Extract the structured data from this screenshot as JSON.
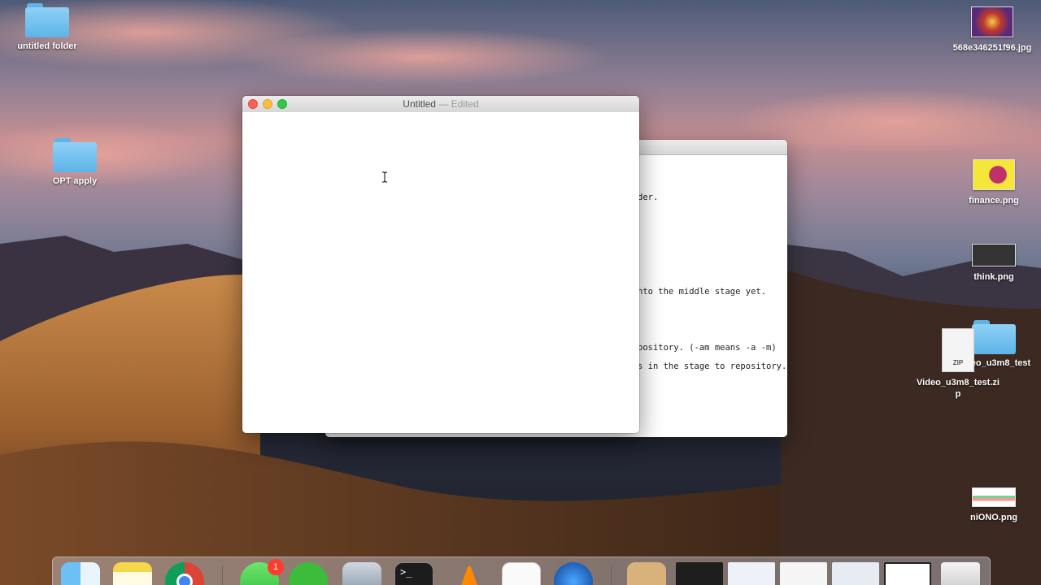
{
  "desktop": {
    "icons": [
      {
        "label": "untitled folder"
      },
      {
        "label": "OPT apply"
      },
      {
        "label": "568e346251f96.jpg"
      },
      {
        "label": "finance.png"
      },
      {
        "label": "think.png"
      },
      {
        "label": "Video_u3m8_test"
      },
      {
        "label": "Video_u3m8_test.zip"
      },
      {
        "label": "niONO.png"
      }
    ],
    "zip_badge": "ZIP"
  },
  "textedit": {
    "title": "Untitled",
    "separator": " — ",
    "status": "Edited"
  },
  "terminal": {
    "lines": [
      "der.",
      "nto the middle stage yet.",
      "pository. (-am means -a -m)",
      "s in the stage to repository."
    ]
  },
  "dock": {
    "messages_badge": "1",
    "terminal_prompt": ">_"
  },
  "colors": {
    "close": "#fc605b",
    "minimize": "#fdbc40",
    "zoom": "#34c84a",
    "badge": "#ff3b30"
  }
}
